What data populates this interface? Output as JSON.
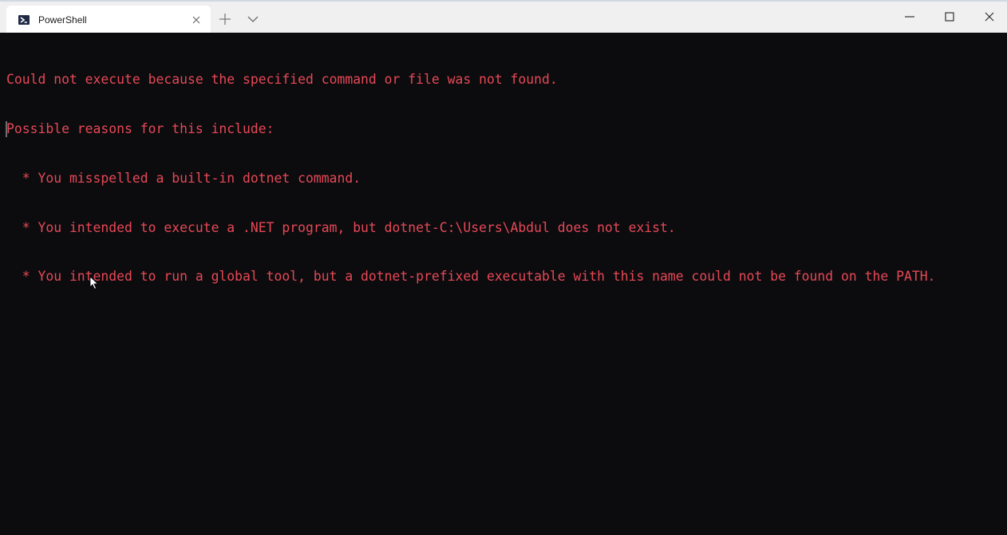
{
  "window": {
    "tabs": [
      {
        "label": "PowerShell",
        "active": true
      }
    ]
  },
  "terminal": {
    "text_color": "#e74856",
    "background": "#0c0c0f",
    "lines": [
      "Could not execute because the specified command or file was not found.",
      "Possible reasons for this include:",
      "  * You misspelled a built-in dotnet command.",
      "  * You intended to execute a .NET program, but dotnet-C:\\Users\\Abdul does not exist.",
      "  * You intended to run a global tool, but a dotnet-prefixed executable with this name could not be found on the PATH."
    ]
  },
  "icons": {
    "tab": "powershell-icon",
    "tab_close": "close-icon",
    "new_tab": "plus-icon",
    "dropdown": "chevron-down-icon",
    "minimize": "minimize-icon",
    "maximize": "maximize-icon",
    "close": "close-icon"
  }
}
